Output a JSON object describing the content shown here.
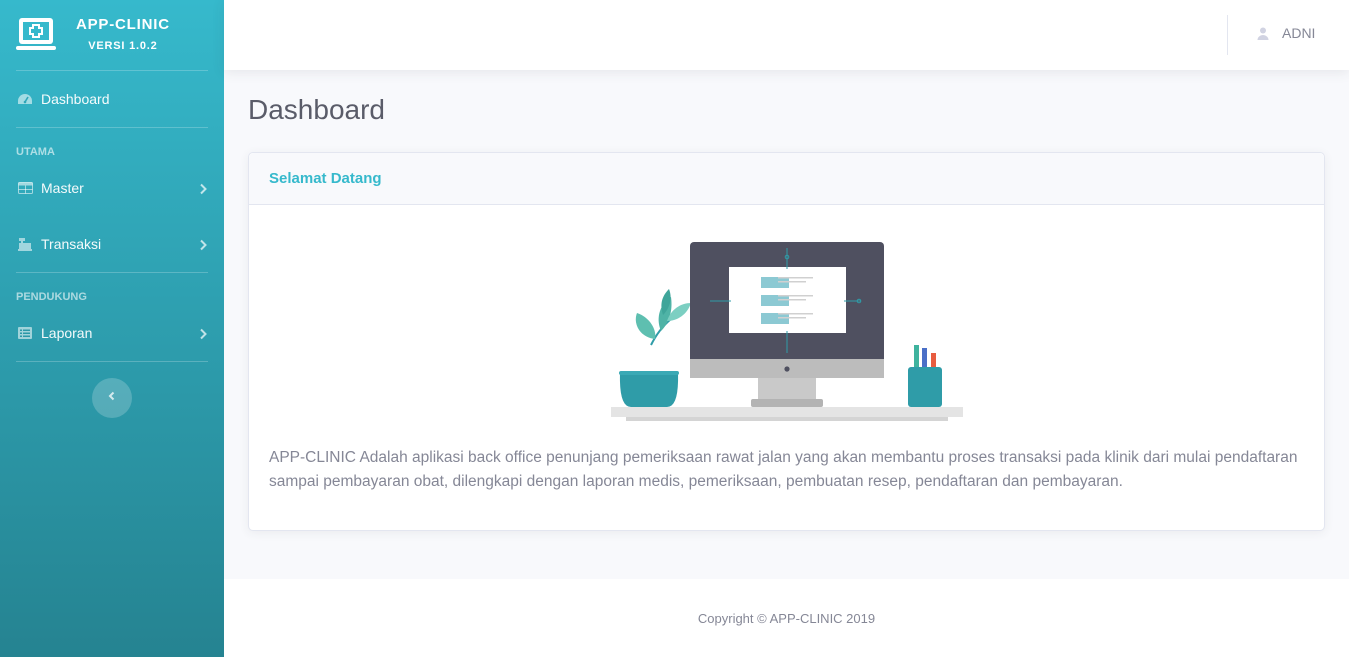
{
  "brand": {
    "title": "APP-CLINIC",
    "version": "VERSI 1.0.2",
    "icon": "monitor-medical-icon"
  },
  "sidebar": {
    "dashboard": {
      "label": "Dashboard",
      "icon": "tachometer-icon"
    },
    "headings": [
      "UTAMA",
      "PENDUKUNG"
    ],
    "items": [
      {
        "label": "Master",
        "icon": "table-icon"
      },
      {
        "label": "Transaksi",
        "icon": "cash-register-icon"
      },
      {
        "label": "Laporan",
        "icon": "list-alt-icon"
      }
    ],
    "toggle_icon": "chevron-left-icon"
  },
  "topbar": {
    "user_name": "ADNI",
    "user_icon": "user-icon"
  },
  "page": {
    "title": "Dashboard",
    "card": {
      "title": "Selamat Datang",
      "description": "APP-CLINIC Adalah aplikasi back office penunjang pemeriksaan rawat jalan yang akan membantu proses transaksi pada klinik dari mulai pendaftaran sampai pembayaran obat, dilengkapi dengan laporan medis, pemeriksaan, pembuatan resep, pendaftaran dan pembayaran."
    }
  },
  "footer": {
    "copyright": "Copyright © APP-CLINIC 2019"
  },
  "colors": {
    "primary": "#36b9cc",
    "primary_dark": "#258391",
    "text": "#5a5c69",
    "muted": "#858796"
  }
}
